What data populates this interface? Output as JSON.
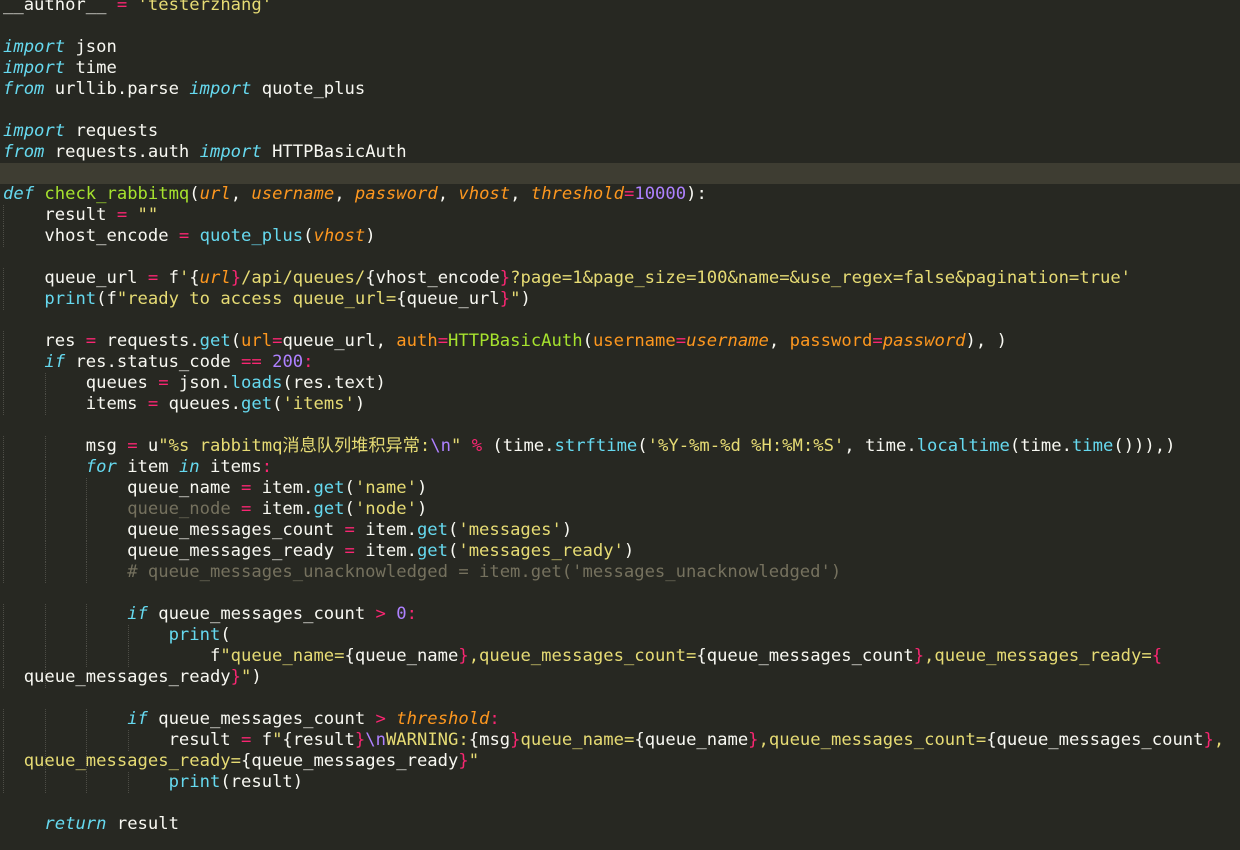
{
  "editor": {
    "language": "python",
    "theme": "monokai",
    "colors": {
      "background": "#272822",
      "active_line": "#3e3d32",
      "keyword": "#f92672",
      "storage": "#66d9ef",
      "function": "#a6e22e",
      "parameter": "#fd971f",
      "string": "#e6db74",
      "number": "#ae81ff",
      "comment": "#75715e",
      "text": "#f8f8f2"
    },
    "active_line_index": 8,
    "lines": [
      {
        "t": [
          [
            "__author__ ",
            ""
          ],
          [
            "=",
            "op"
          ],
          [
            " ",
            ""
          ],
          [
            "'testerzhang'",
            "str"
          ]
        ]
      },
      {
        "t": []
      },
      {
        "t": [
          [
            "import",
            "kwi"
          ],
          [
            " json",
            ""
          ]
        ]
      },
      {
        "t": [
          [
            "import",
            "kwi"
          ],
          [
            " time",
            ""
          ]
        ]
      },
      {
        "t": [
          [
            "from",
            "kwi"
          ],
          [
            " urllib.parse ",
            ""
          ],
          [
            "import",
            "kwi"
          ],
          [
            " quote_plus",
            ""
          ]
        ]
      },
      {
        "t": []
      },
      {
        "t": [
          [
            "import",
            "kwi"
          ],
          [
            " requests",
            ""
          ]
        ]
      },
      {
        "t": [
          [
            "from",
            "kwi"
          ],
          [
            " requests.auth ",
            ""
          ],
          [
            "import",
            "kwi"
          ],
          [
            " HTTPBasicAuth",
            ""
          ]
        ]
      },
      {
        "t": []
      },
      {
        "t": [
          [
            "def",
            "kwi"
          ],
          [
            " ",
            ""
          ],
          [
            "check_rabbitmq",
            "fn"
          ],
          [
            "(",
            ""
          ],
          [
            "url",
            "param"
          ],
          [
            ", ",
            ""
          ],
          [
            "username",
            "param"
          ],
          [
            ", ",
            ""
          ],
          [
            "password",
            "param"
          ],
          [
            ", ",
            ""
          ],
          [
            "vhost",
            "param"
          ],
          [
            ", ",
            ""
          ],
          [
            "threshold",
            "param"
          ],
          [
            "=",
            "op"
          ],
          [
            "10000",
            "num"
          ],
          [
            "):",
            ""
          ]
        ]
      },
      {
        "t": [
          [
            "    result ",
            ""
          ],
          [
            "=",
            "op"
          ],
          [
            " ",
            ""
          ],
          [
            "\"\"",
            "str"
          ]
        ]
      },
      {
        "t": [
          [
            "    vhost_encode ",
            ""
          ],
          [
            "=",
            "op"
          ],
          [
            " ",
            ""
          ],
          [
            "quote_plus",
            "bi"
          ],
          [
            "(",
            ""
          ],
          [
            "vhost",
            "param"
          ],
          [
            ")",
            ""
          ]
        ]
      },
      {
        "t": []
      },
      {
        "t": [
          [
            "    queue_url ",
            ""
          ],
          [
            "=",
            "op"
          ],
          [
            " f",
            ""
          ],
          [
            "'",
            "str"
          ],
          [
            "{",
            ""
          ],
          [
            "url",
            "param"
          ],
          [
            "}",
            "op"
          ],
          [
            "/api/queues/",
            "str"
          ],
          [
            "{",
            ""
          ],
          [
            "vhost_encode",
            ""
          ],
          [
            "}",
            "op"
          ],
          [
            "?page=1&page_size=100&name=&use_regex=false&pagination=true'",
            "str"
          ]
        ]
      },
      {
        "t": [
          [
            "    ",
            ""
          ],
          [
            "print",
            "bi"
          ],
          [
            "(f",
            ""
          ],
          [
            "\"ready to access queue_url=",
            "str"
          ],
          [
            "{",
            ""
          ],
          [
            "queue_url",
            ""
          ],
          [
            "}",
            "op"
          ],
          [
            "\"",
            "str"
          ],
          [
            ")",
            ""
          ]
        ]
      },
      {
        "t": []
      },
      {
        "t": [
          [
            "    res ",
            ""
          ],
          [
            "=",
            "op"
          ],
          [
            " requests.",
            ""
          ],
          [
            "get",
            "meth"
          ],
          [
            "(",
            ""
          ],
          [
            "url",
            "kwarg"
          ],
          [
            "=",
            "op"
          ],
          [
            "queue_url, ",
            ""
          ],
          [
            "auth",
            "kwarg"
          ],
          [
            "=",
            "op"
          ],
          [
            "HTTPBasicAuth",
            "cl"
          ],
          [
            "(",
            ""
          ],
          [
            "username",
            "kwarg"
          ],
          [
            "=",
            "op"
          ],
          [
            "username",
            "param"
          ],
          [
            ", ",
            ""
          ],
          [
            "password",
            "kwarg"
          ],
          [
            "=",
            "op"
          ],
          [
            "password",
            "param"
          ],
          [
            "), )",
            ""
          ]
        ]
      },
      {
        "t": [
          [
            "    ",
            ""
          ],
          [
            "if",
            "kwi"
          ],
          [
            " res.status_code ",
            ""
          ],
          [
            "==",
            "op"
          ],
          [
            " ",
            ""
          ],
          [
            "200",
            "num"
          ],
          [
            ":",
            "op"
          ]
        ]
      },
      {
        "t": [
          [
            "        queues ",
            ""
          ],
          [
            "=",
            "op"
          ],
          [
            " json.",
            ""
          ],
          [
            "loads",
            "meth"
          ],
          [
            "(res.text)",
            ""
          ]
        ]
      },
      {
        "t": [
          [
            "        items ",
            ""
          ],
          [
            "=",
            "op"
          ],
          [
            " queues.",
            ""
          ],
          [
            "get",
            "meth"
          ],
          [
            "(",
            ""
          ],
          [
            "'items'",
            "str"
          ],
          [
            ")",
            ""
          ]
        ]
      },
      {
        "t": []
      },
      {
        "t": [
          [
            "        msg ",
            ""
          ],
          [
            "=",
            "op"
          ],
          [
            " u",
            ""
          ],
          [
            "\"%s rabbitmq消息队列堆积异常:",
            "str"
          ],
          [
            "\\n",
            "esc"
          ],
          [
            "\"",
            "str"
          ],
          [
            " ",
            ""
          ],
          [
            "%",
            "op"
          ],
          [
            " (time.",
            ""
          ],
          [
            "strftime",
            "meth"
          ],
          [
            "(",
            ""
          ],
          [
            "'%Y-%m-%d %H:%M:%S'",
            "str"
          ],
          [
            ", time.",
            ""
          ],
          [
            "localtime",
            "meth"
          ],
          [
            "(time.",
            ""
          ],
          [
            "time",
            "meth"
          ],
          [
            "())),)",
            ""
          ]
        ]
      },
      {
        "t": [
          [
            "        ",
            ""
          ],
          [
            "for",
            "kwi"
          ],
          [
            " item ",
            ""
          ],
          [
            "in",
            "kwi"
          ],
          [
            " items",
            ""
          ],
          [
            ":",
            "op"
          ]
        ]
      },
      {
        "t": [
          [
            "            queue_name ",
            ""
          ],
          [
            "=",
            "op"
          ],
          [
            " item.",
            ""
          ],
          [
            "get",
            "meth"
          ],
          [
            "(",
            ""
          ],
          [
            "'name'",
            "str"
          ],
          [
            ")",
            ""
          ]
        ]
      },
      {
        "t": [
          [
            "            ",
            ""
          ],
          [
            "queue_node",
            "dim"
          ],
          [
            " ",
            ""
          ],
          [
            "=",
            "op"
          ],
          [
            " item.",
            ""
          ],
          [
            "get",
            "meth"
          ],
          [
            "(",
            ""
          ],
          [
            "'node'",
            "str"
          ],
          [
            ")",
            ""
          ]
        ]
      },
      {
        "t": [
          [
            "            queue_messages_count ",
            ""
          ],
          [
            "=",
            "op"
          ],
          [
            " item.",
            ""
          ],
          [
            "get",
            "meth"
          ],
          [
            "(",
            ""
          ],
          [
            "'messages'",
            "str"
          ],
          [
            ")",
            ""
          ]
        ]
      },
      {
        "t": [
          [
            "            queue_messages_ready ",
            ""
          ],
          [
            "=",
            "op"
          ],
          [
            " item.",
            ""
          ],
          [
            "get",
            "meth"
          ],
          [
            "(",
            ""
          ],
          [
            "'messages_ready'",
            "str"
          ],
          [
            ")",
            ""
          ]
        ]
      },
      {
        "t": [
          [
            "            ",
            ""
          ],
          [
            "# queue_messages_unacknowledged = item.get('messages_unacknowledged')",
            "cmt"
          ]
        ]
      },
      {
        "t": []
      },
      {
        "t": [
          [
            "            ",
            ""
          ],
          [
            "if",
            "kwi"
          ],
          [
            " queue_messages_count ",
            ""
          ],
          [
            ">",
            "op"
          ],
          [
            " ",
            ""
          ],
          [
            "0",
            "num"
          ],
          [
            ":",
            "op"
          ]
        ]
      },
      {
        "t": [
          [
            "                ",
            ""
          ],
          [
            "print",
            "bi"
          ],
          [
            "(",
            ""
          ]
        ]
      },
      {
        "t": [
          [
            "                    f",
            ""
          ],
          [
            "\"queue_name=",
            "str"
          ],
          [
            "{",
            ""
          ],
          [
            "queue_name",
            ""
          ],
          [
            "}",
            "op"
          ],
          [
            ",queue_messages_count=",
            "str"
          ],
          [
            "{",
            ""
          ],
          [
            "queue_messages_count",
            ""
          ],
          [
            "}",
            "op"
          ],
          [
            ",queue_messages_ready=",
            "str"
          ],
          [
            "{",
            "op"
          ]
        ]
      },
      {
        "t": [
          [
            "  queue_messages_ready",
            ""
          ],
          [
            "}",
            "op"
          ],
          [
            "\"",
            "str"
          ],
          [
            ")",
            ""
          ]
        ]
      },
      {
        "t": []
      },
      {
        "t": [
          [
            "            ",
            ""
          ],
          [
            "if",
            "kwi"
          ],
          [
            " queue_messages_count ",
            ""
          ],
          [
            ">",
            "op"
          ],
          [
            " ",
            ""
          ],
          [
            "threshold",
            "param"
          ],
          [
            ":",
            "op"
          ]
        ]
      },
      {
        "t": [
          [
            "                result ",
            ""
          ],
          [
            "=",
            "op"
          ],
          [
            " f",
            ""
          ],
          [
            "\"",
            "str"
          ],
          [
            "{",
            ""
          ],
          [
            "result",
            ""
          ],
          [
            "}",
            "op"
          ],
          [
            "\\n",
            "esc"
          ],
          [
            "WARNING:",
            "str"
          ],
          [
            "{",
            ""
          ],
          [
            "msg",
            ""
          ],
          [
            "}",
            "op"
          ],
          [
            "queue_name=",
            "str"
          ],
          [
            "{",
            ""
          ],
          [
            "queue_name",
            ""
          ],
          [
            "}",
            "op"
          ],
          [
            ",queue_messages_count=",
            "str"
          ],
          [
            "{",
            ""
          ],
          [
            "queue_messages_count",
            ""
          ],
          [
            "}",
            "op"
          ],
          [
            ",",
            "str"
          ]
        ]
      },
      {
        "t": [
          [
            "  ",
            ""
          ],
          [
            "queue_messages_ready=",
            "str"
          ],
          [
            "{",
            ""
          ],
          [
            "queue_messages_ready",
            ""
          ],
          [
            "}",
            "op"
          ],
          [
            "\"",
            "str"
          ]
        ]
      },
      {
        "t": [
          [
            "                ",
            ""
          ],
          [
            "print",
            "bi"
          ],
          [
            "(result)",
            ""
          ]
        ]
      },
      {
        "t": []
      },
      {
        "t": [
          [
            "    ",
            ""
          ],
          [
            "return",
            "kwi"
          ],
          [
            " result",
            ""
          ]
        ]
      }
    ]
  }
}
